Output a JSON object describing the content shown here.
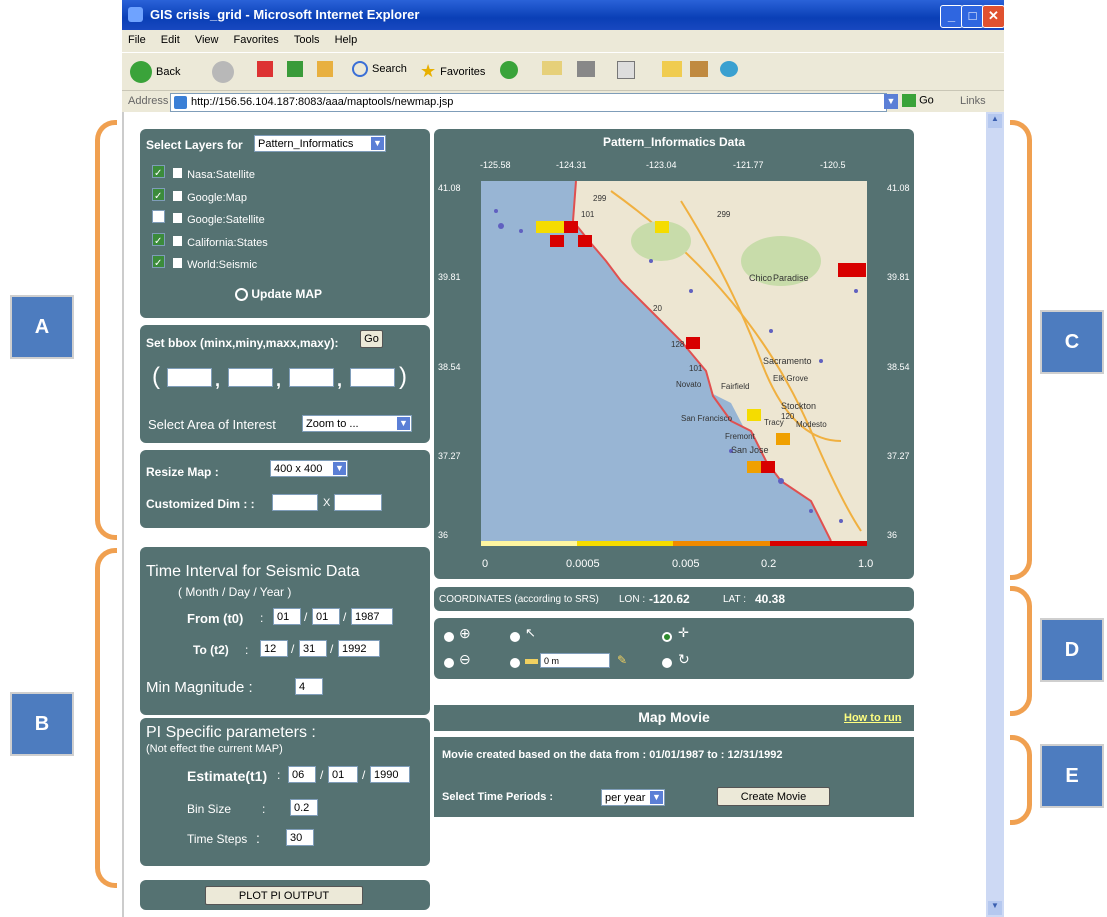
{
  "window": {
    "title": "GIS crisis_grid - Microsoft Internet Explorer"
  },
  "menu": [
    "File",
    "Edit",
    "View",
    "Favorites",
    "Tools",
    "Help"
  ],
  "toolbar": {
    "back": "Back",
    "search": "Search",
    "favorites": "Favorites"
  },
  "address": {
    "label": "Address",
    "url": "http://156.56.104.187:8083/aaa/maptools/newmap.jsp",
    "go": "Go",
    "links": "Links"
  },
  "layers": {
    "label": "Select Layers for",
    "selected": "Pattern_Informatics",
    "items": [
      {
        "name": "Nasa:Satellite",
        "checked": true
      },
      {
        "name": "Google:Map",
        "checked": true
      },
      {
        "name": "Google:Satellite",
        "checked": false
      },
      {
        "name": "California:States",
        "checked": true
      },
      {
        "name": "World:Seismic",
        "checked": true
      }
    ],
    "update": "Update MAP"
  },
  "bbox": {
    "label": "Set bbox (minx,miny,maxx,maxy):",
    "go": "Go",
    "open": "(",
    "close": ")",
    "comma": ",",
    "area_label": "Select Area of Interest",
    "area_value": "Zoom to ..."
  },
  "resize": {
    "label": "Resize Map :",
    "value": "400 x 400",
    "custom_label": "Customized Dim : :",
    "x": "X"
  },
  "time": {
    "title": "Time Interval for Seismic Data",
    "subtitle": "( Month / Day / Year )",
    "from_label": "From (t0)",
    "from": [
      "01",
      "01",
      "1987"
    ],
    "to_label": "To (t2)",
    "to": [
      "12",
      "31",
      "1992"
    ],
    "colon": ":",
    "slash": "/",
    "mag_label": "Min Magnitude :",
    "mag": "4"
  },
  "pi": {
    "title": "PI Specific parameters :",
    "subtitle": "(Not effect the current MAP)",
    "est_label": "Estimate(t1)",
    "est": [
      "06",
      "01",
      "1990"
    ],
    "bin_label": "Bin Size",
    "bin": "0.2",
    "steps_label": "Time Steps",
    "steps": "30"
  },
  "plot_button": "PLOT PI OUTPUT",
  "map": {
    "title": "Pattern_Informatics Data",
    "lon_ticks": [
      "-125.58",
      "-124.31",
      "-123.04",
      "-121.77",
      "-120.5"
    ],
    "lat_ticks": [
      "41.08",
      "39.81",
      "38.54",
      "37.27",
      "36"
    ],
    "scale_labels": [
      "0",
      "0.0005",
      "0.005",
      "0.2",
      "1.0"
    ],
    "scale_colors": [
      "#fff6a0",
      "#f5dc00",
      "#f08a00",
      "#d80000"
    ],
    "places": [
      "Chico",
      "Paradise",
      "Sacramento",
      "Elk Grove",
      "Fairfield",
      "Novato",
      "Stockton",
      "Tracy",
      "Modesto",
      "San Francisco",
      "Fremont",
      "San Jose"
    ],
    "roads": [
      "299",
      "101",
      "299",
      "20",
      "128",
      "101",
      "120"
    ]
  },
  "coords": {
    "label": "COORDINATES (according to SRS)",
    "lon_label": "LON :",
    "lon": "-120.62",
    "lat_label": "LAT :",
    "lat": "40.38"
  },
  "tools": {
    "measure": "0 m"
  },
  "movie": {
    "title": "Map Movie",
    "howto": "How to run",
    "info": "Movie created based on the data from : 01/01/1987 to : 12/31/1992",
    "period_label": "Select Time Periods :",
    "period": "per year",
    "create": "Create Movie"
  },
  "callouts": [
    "A",
    "B",
    "C",
    "D",
    "E"
  ]
}
